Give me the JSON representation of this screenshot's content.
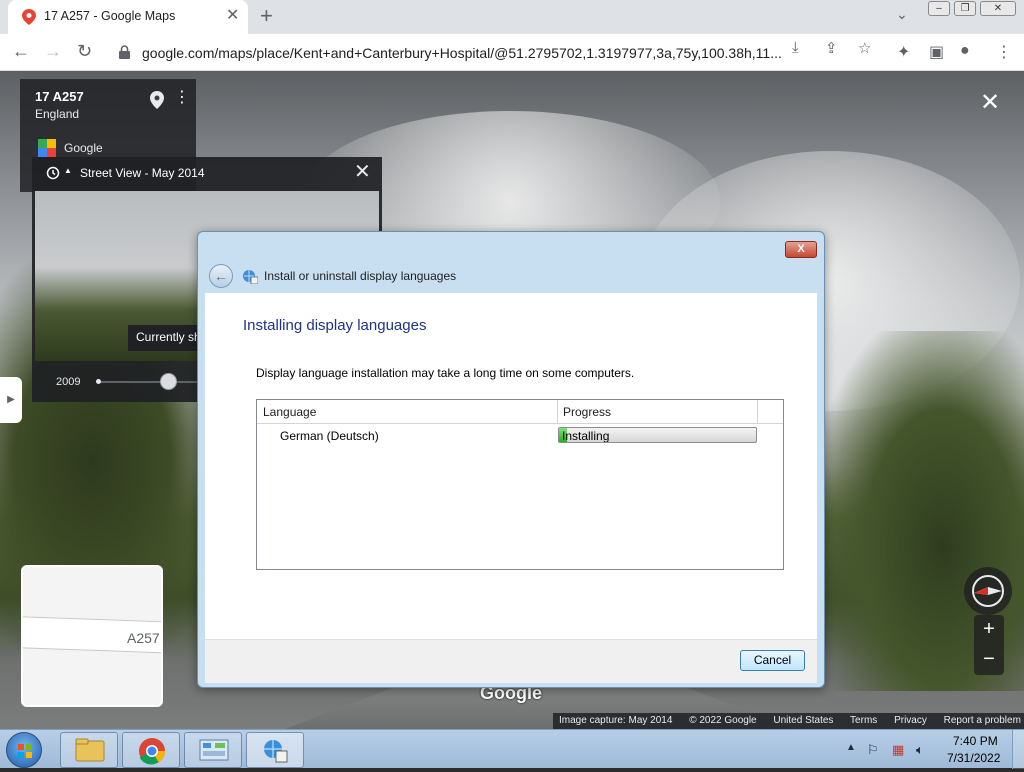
{
  "browser": {
    "tab_title": "17 A257 - Google Maps",
    "url": "google.com/maps/place/Kent+and+Canterbury+Hospital/@51.2795702,1.3197977,3a,75y,100.38h,11..."
  },
  "location_card": {
    "title": "17 A257",
    "subtitle": "England",
    "provider": "Google"
  },
  "street_view_panel": {
    "title": "Street View - May 2014",
    "tooltip": "Currently sh",
    "timeline_year": "2009"
  },
  "minimap": {
    "road_label": "A257"
  },
  "map": {
    "watermark": "Google",
    "attribution": [
      "Image capture: May 2014",
      "© 2022 Google",
      "United States",
      "Terms",
      "Privacy",
      "Report a problem"
    ]
  },
  "dialog": {
    "header_title": "Install or uninstall display languages",
    "heading": "Installing display languages",
    "description": "Display language installation may take a long time on some computers.",
    "columns": {
      "language": "Language",
      "progress": "Progress"
    },
    "row": {
      "language": "German (Deutsch)",
      "status": "Installing",
      "progress_fraction": 0.04
    },
    "cancel_label": "Cancel",
    "close_label": "X"
  },
  "taskbar": {
    "time": "7:40 PM",
    "date": "7/31/2022"
  },
  "colors": {
    "dialog_heading": "#1e3287",
    "progress_green": "#1db51a",
    "taskbar": "#b7cee6"
  }
}
